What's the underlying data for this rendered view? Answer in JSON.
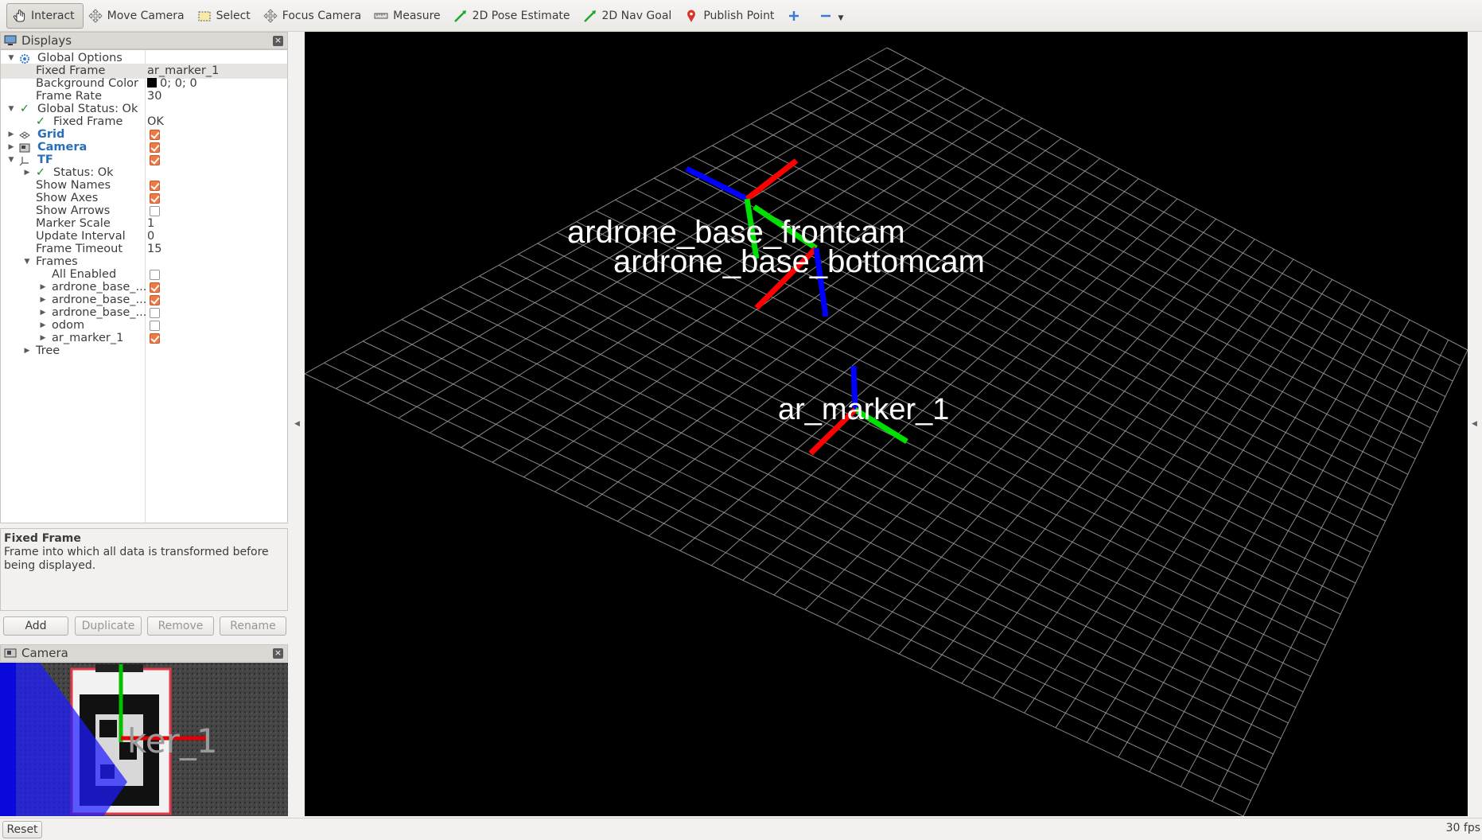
{
  "toolbar": {
    "interact": "Interact",
    "move_camera": "Move Camera",
    "select": "Select",
    "focus_camera": "Focus Camera",
    "measure": "Measure",
    "pose_estimate": "2D Pose Estimate",
    "nav_goal": "2D Nav Goal",
    "publish_point": "Publish Point"
  },
  "displays_panel": {
    "title": "Displays",
    "rows": {
      "global_options": "Global Options",
      "fixed_frame": {
        "label": "Fixed Frame",
        "value": "ar_marker_1"
      },
      "background_color": {
        "label": "Background Color",
        "value": "0; 0; 0"
      },
      "frame_rate": {
        "label": "Frame Rate",
        "value": "30"
      },
      "global_status": "Global Status: Ok",
      "fixed_frame_status": {
        "label": "Fixed Frame",
        "value": "OK"
      },
      "grid": "Grid",
      "camera": "Camera",
      "tf": "TF",
      "tf_status": "Status: Ok",
      "show_names": "Show Names",
      "show_axes": "Show Axes",
      "show_arrows": "Show Arrows",
      "marker_scale": {
        "label": "Marker Scale",
        "value": "1"
      },
      "update_interval": {
        "label": "Update Interval",
        "value": "0"
      },
      "frame_timeout": {
        "label": "Frame Timeout",
        "value": "15"
      },
      "frames": "Frames",
      "all_enabled": "All Enabled",
      "frame_1": "ardrone_base_...",
      "frame_2": "ardrone_base_...",
      "frame_3": "ardrone_base_...",
      "frame_odom": "odom",
      "frame_marker": "ar_marker_1",
      "tree": "Tree"
    },
    "checks": {
      "grid": true,
      "camera": true,
      "tf": true,
      "show_names": true,
      "show_axes": true,
      "show_arrows": false,
      "all_enabled": false,
      "frame_1": true,
      "frame_2": true,
      "frame_3": false,
      "frame_odom": false,
      "frame_marker": true
    }
  },
  "description": {
    "title": "Fixed Frame",
    "text": "Frame into which all data is transformed before being displayed."
  },
  "buttons": {
    "add": "Add",
    "duplicate": "Duplicate",
    "remove": "Remove",
    "rename": "Rename"
  },
  "camera_panel": {
    "title": "Camera",
    "overlay_text": "ker_1"
  },
  "viewport": {
    "labels": {
      "frontcam": "ardrone_base_frontcam",
      "bottomcam": "ardrone_base_bottomcam",
      "marker": "ar_marker_1"
    },
    "colors": {
      "x_axis": "#ff0000",
      "y_axis": "#00e000",
      "z_axis": "#0000ff",
      "grid": "#a0a0a0"
    }
  },
  "statusbar": {
    "reset": "Reset",
    "fps": "30 fps"
  }
}
